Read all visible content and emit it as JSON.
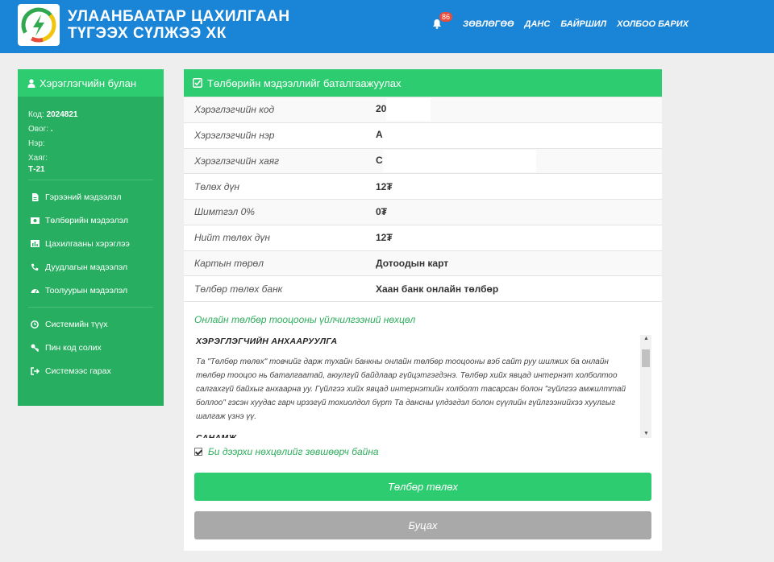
{
  "header": {
    "brand_line1": "УЛААНБААТАР ЦАХИЛГААН",
    "brand_line2": "ТҮГЭЭХ СҮЛЖЭЭ ХК",
    "notification_count": "86",
    "nav": [
      "ЗӨВЛӨГӨӨ",
      "ДАНС",
      "БАЙРШИЛ",
      "ХОЛБОО БАРИХ"
    ]
  },
  "sidebar": {
    "title": "Хэрэглэгчийн булан",
    "info": {
      "code_label": "Код:",
      "code_value": "2024821",
      "surname_label": "Овог:",
      "surname_value": ".",
      "name_label": "Нэр:",
      "name_value": "",
      "address_label": "Хаяг:",
      "address_value": "Т-21"
    },
    "menu1": [
      {
        "label": "Гэрээний мэдээлэл",
        "icon": "document-icon"
      },
      {
        "label": "Төлбөрийн мэдээлэл",
        "icon": "money-icon"
      },
      {
        "label": "Цахилгааны хэрэглээ",
        "icon": "chart-icon"
      },
      {
        "label": "Дуудлагын мэдээлэл",
        "icon": "phone-icon"
      },
      {
        "label": "Тоолуурын мэдээлэл",
        "icon": "dashboard-icon"
      }
    ],
    "menu2": [
      {
        "label": "Системийн түүх",
        "icon": "clock-icon"
      },
      {
        "label": "Пин код солих",
        "icon": "key-icon"
      },
      {
        "label": "Системээс гарах",
        "icon": "logout-icon"
      }
    ]
  },
  "panel": {
    "title": "Төлбөрийн мэдээллийг баталгаажуулах",
    "rows": [
      {
        "label": "Хэрэглэгчийн код",
        "value": "20"
      },
      {
        "label": "Хэрэглэгчийн нэр",
        "value": "А"
      },
      {
        "label": "Хэрэглэгчийн хаяг",
        "value": "С"
      },
      {
        "label": "Төлөх дүн",
        "value": "12₮"
      },
      {
        "label": "Шимтгэл 0%",
        "value": "0₮"
      },
      {
        "label": "Нийт төлөх дүн",
        "value": "12₮"
      },
      {
        "label": "Картын төрөл",
        "value": "Дотоодын карт"
      },
      {
        "label": "Төлбөр төлөх банк",
        "value": "Хаан банк онлайн төлбөр"
      }
    ],
    "terms_title": "Онлайн төлбөр тооцооны үйлчилгээний нөхцөл",
    "terms_heading1": "ХЭРЭГЛЭГЧИЙН АНХААРУУЛГА",
    "terms_body1": "Та \"Төлбөр төлөх\" товчийг дарж тухайн банкны онлайн төлбөр тооцооны вэб сайт руу шилжих ба онлайн төлбөр тооцоо нь баталгаатай, аюулгүй байдлаар гүйцэтгэгдэнэ. Төлбөр хийх явцад интернэт холболтоо салгахгүй байхыг анхаарна уу. Гүйлгээ хийх явцад интернэтийн холболт тасарсан болон \"гүйлгээ амжилттай боллоо\" гэсэн хуудас гарч ирээгүй тохиолдол бүрт Та дансны үлдэгдэл болон сүүлийн гүйлгээнийхээ хуулгыг шалгаж үзнэ үү.",
    "terms_heading2": "САНАМЖ",
    "agree_label": "Би дээрхи нөхцөлийг зөвшөөрч байна",
    "pay_button": "Төлбөр төлөх",
    "cancel_button": "Буцах"
  }
}
